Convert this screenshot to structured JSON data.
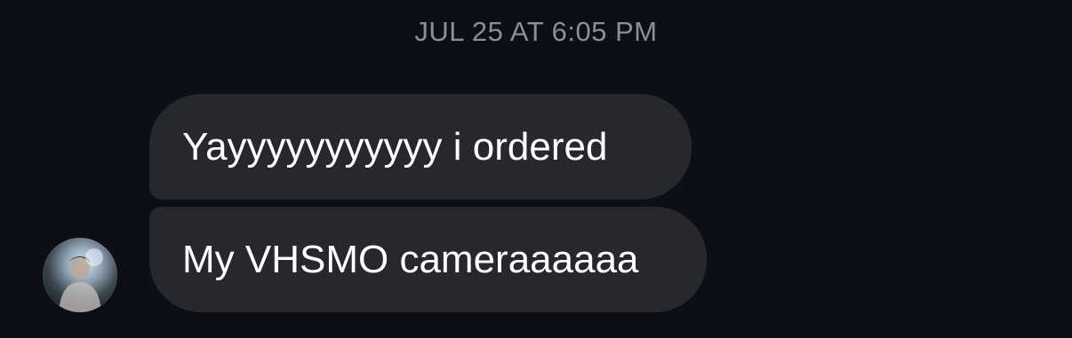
{
  "thread": {
    "timestamp": "JUL 25 AT 6:05 PM",
    "messages": [
      {
        "text": "Yayyyyyyyyyyy i ordered"
      },
      {
        "text": "My VHSMO cameraaaaaa"
      }
    ]
  },
  "sender": {
    "avatar_icon": "profile-photo"
  },
  "colors": {
    "background": "#0c1016",
    "bubble": "#26282d",
    "timestamp_text": "#8e8e93",
    "message_text": "#ffffff"
  }
}
